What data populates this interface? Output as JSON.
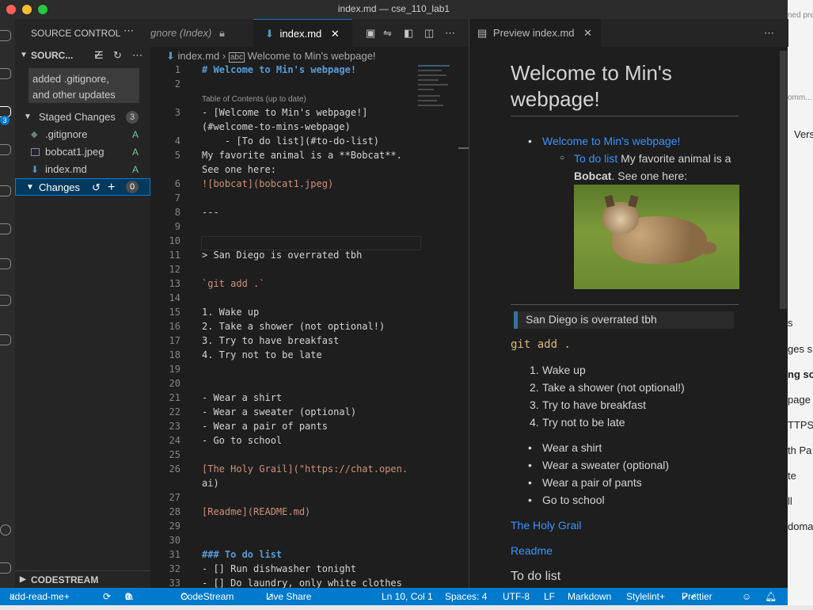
{
  "window": {
    "title": "index.md — cse_110_lab1"
  },
  "background_window": {
    "texts": [
      "ned pre",
      "omm...",
      "Vers",
      "s",
      "ges s",
      "ng sc",
      "page",
      "TTPS",
      "th Pa",
      "te",
      "ll",
      "doma"
    ]
  },
  "sidebar": {
    "header": "SOURCE CONTROL",
    "section_title": "SOURC...",
    "commit_message": "added .gitignore,\nand other updates",
    "staged": {
      "label": "Staged Changes",
      "count": "3",
      "files": [
        {
          "name": ".gitignore",
          "status": "A"
        },
        {
          "name": "bobcat1.jpeg",
          "status": "A"
        },
        {
          "name": "index.md",
          "status": "A"
        }
      ]
    },
    "changes": {
      "label": "Changes",
      "count": "0"
    },
    "codestream": "CODESTREAM"
  },
  "editor": {
    "tabs": [
      {
        "label": "gnore (Index)"
      },
      {
        "label": "index.md"
      }
    ],
    "breadcrumb": {
      "file": "index.md",
      "section": "Welcome to Min's webpage!"
    },
    "toc_hint": "Table of Contents (up to date)",
    "lines": [
      {
        "n": "1",
        "text": "# Welcome to Min's webpage!"
      },
      {
        "n": "2",
        "text": ""
      },
      {
        "n": "3",
        "text": "- [Welcome to Min's webpage!]"
      },
      {
        "n": "",
        "text": "(#welcome-to-mins-webpage)"
      },
      {
        "n": "4",
        "text": "    - [To do list](#to-do-list)"
      },
      {
        "n": "5",
        "text": "My favorite animal is a **Bobcat**."
      },
      {
        "n": "",
        "text": "See one here:"
      },
      {
        "n": "6",
        "text": "![bobcat](bobcat1.jpeg)"
      },
      {
        "n": "7",
        "text": ""
      },
      {
        "n": "8",
        "text": "---"
      },
      {
        "n": "9",
        "text": ""
      },
      {
        "n": "10",
        "text": ""
      },
      {
        "n": "11",
        "text": "> San Diego is overrated tbh"
      },
      {
        "n": "12",
        "text": ""
      },
      {
        "n": "13",
        "text": "`git add .`"
      },
      {
        "n": "14",
        "text": ""
      },
      {
        "n": "15",
        "text": "1. Wake up"
      },
      {
        "n": "16",
        "text": "2. Take a shower (not optional!)"
      },
      {
        "n": "17",
        "text": "3. Try to have breakfast"
      },
      {
        "n": "18",
        "text": "4. Try not to be late"
      },
      {
        "n": "19",
        "text": ""
      },
      {
        "n": "20",
        "text": ""
      },
      {
        "n": "21",
        "text": "- Wear a shirt"
      },
      {
        "n": "22",
        "text": "- Wear a sweater (optional)"
      },
      {
        "n": "23",
        "text": "- Wear a pair of pants"
      },
      {
        "n": "24",
        "text": "- Go to school"
      },
      {
        "n": "25",
        "text": ""
      },
      {
        "n": "26",
        "text": "[The Holy Grail](\"https://chat.open."
      },
      {
        "n": "",
        "text": "ai)"
      },
      {
        "n": "27",
        "text": ""
      },
      {
        "n": "28",
        "text": "[Readme](README.md)"
      },
      {
        "n": "29",
        "text": ""
      },
      {
        "n": "30",
        "text": ""
      },
      {
        "n": "31",
        "text": "### To do list"
      },
      {
        "n": "32",
        "text": "- [] Run dishwasher tonight"
      },
      {
        "n": "33",
        "text": "- [] Do laundry, only white clothes"
      }
    ]
  },
  "preview": {
    "tab_label": "Preview index.md",
    "heading_line1": "Welcome to Min's",
    "heading_line2": "webpage!",
    "toc_link1": "Welcome to Min's webpage!",
    "toc_link2": "To do list",
    "inline_text1": " My favorite animal is a",
    "bold_word": "Bobcat",
    "inline_text2": ". See one here:",
    "quote": "San Diego is overrated tbh",
    "code": "git add .",
    "ordered": [
      "Wake up",
      "Take a shower (not optional!)",
      "Try to have breakfast",
      "Try not to be late"
    ],
    "bullets": [
      "Wear a shirt",
      "Wear a sweater (optional)",
      "Wear a pair of pants",
      "Go to school"
    ],
    "link_grail": "The Holy Grail",
    "link_readme": "Readme",
    "todo_heading": "To do list"
  },
  "statusbar": {
    "branch": "add-read-me+",
    "problems": "0",
    "warnings": "0",
    "codestream": "CodeStream",
    "liveshare": "Live Share",
    "position": "Ln 10, Col 1",
    "spaces": "Spaces: 4",
    "encoding": "UTF-8",
    "eol": "LF",
    "language": "Markdown",
    "stylelint": "Stylelint+",
    "prettier": "Prettier"
  }
}
